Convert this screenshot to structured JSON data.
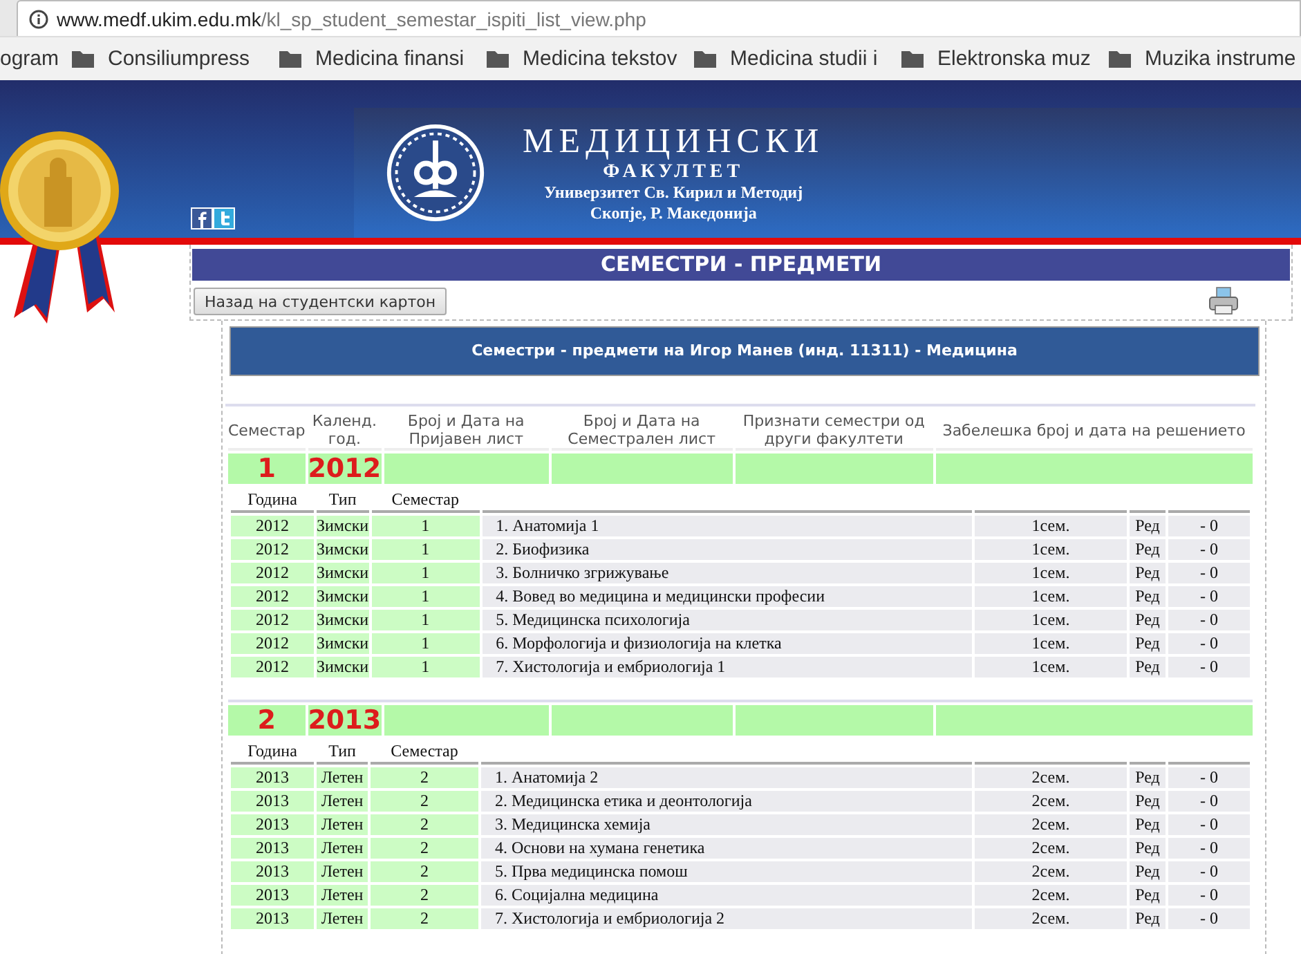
{
  "browser": {
    "url_host": "www.medf.ukim.edu.mk",
    "url_path": "/kl_sp_student_semestar_ispiti_list_view.php",
    "bookmarks": [
      {
        "label": "ogram",
        "folder": false
      },
      {
        "label": "Consiliumpress",
        "folder": true
      },
      {
        "label": "Medicina finansi",
        "folder": true
      },
      {
        "label": "Medicina tekstov",
        "folder": true
      },
      {
        "label": "Medicina studii i",
        "folder": true
      },
      {
        "label": "Elektronska muz",
        "folder": true
      },
      {
        "label": "Muzika instrume",
        "folder": true
      }
    ]
  },
  "header": {
    "title": "МЕДИЦИНСКИ",
    "subtitle": "ФАКУЛТЕТ",
    "university": "Универзитет Св. Кирил и Методиј",
    "city": "Скопје, Р. Македонија"
  },
  "page_title": "СЕМЕСТРИ - ПРЕДМЕТИ",
  "back_button": "Назад на студентски картон",
  "student_heading": "Семестри - предмети на Игор Манев  (инд. 11311) - Медицина",
  "columns": [
    "Семестар",
    "Календ. год.",
    "Број и Дата на Пријавен лист",
    "Број и Дата на Семестрален лист",
    "Признати семестри од други факултети",
    "Забелешка број и дата на решението"
  ],
  "semesters": [
    {
      "number": "1",
      "year": "2012",
      "subject_columns": [
        "Година",
        "Тип",
        "Семестар"
      ],
      "subjects": [
        {
          "year": "2012",
          "type": "Зимски",
          "semester": "1",
          "name": "1. Анатомија 1",
          "sem": "1сем.",
          "status": "Ред",
          "grade": "- 0"
        },
        {
          "year": "2012",
          "type": "Зимски",
          "semester": "1",
          "name": "2. Биофизика",
          "sem": "1сем.",
          "status": "Ред",
          "grade": "- 0"
        },
        {
          "year": "2012",
          "type": "Зимски",
          "semester": "1",
          "name": "3. Болничко згрижување",
          "sem": "1сем.",
          "status": "Ред",
          "grade": "- 0"
        },
        {
          "year": "2012",
          "type": "Зимски",
          "semester": "1",
          "name": "4. Вовед во медицина и медицински професии",
          "sem": "1сем.",
          "status": "Ред",
          "grade": "- 0"
        },
        {
          "year": "2012",
          "type": "Зимски",
          "semester": "1",
          "name": "5. Медицинска психологија",
          "sem": "1сем.",
          "status": "Ред",
          "grade": "- 0"
        },
        {
          "year": "2012",
          "type": "Зимски",
          "semester": "1",
          "name": "6. Морфологија и физиологија на клетка",
          "sem": "1сем.",
          "status": "Ред",
          "grade": "- 0"
        },
        {
          "year": "2012",
          "type": "Зимски",
          "semester": "1",
          "name": "7. Хистологија и ембриологија 1",
          "sem": "1сем.",
          "status": "Ред",
          "grade": "- 0"
        }
      ]
    },
    {
      "number": "2",
      "year": "2013",
      "subject_columns": [
        "Година",
        "Тип",
        "Семестар"
      ],
      "subjects": [
        {
          "year": "2013",
          "type": "Летен",
          "semester": "2",
          "name": "1. Анатомија 2",
          "sem": "2сем.",
          "status": "Ред",
          "grade": "- 0"
        },
        {
          "year": "2013",
          "type": "Летен",
          "semester": "2",
          "name": "2. Медицинска етика и деонтологија",
          "sem": "2сем.",
          "status": "Ред",
          "grade": "- 0"
        },
        {
          "year": "2013",
          "type": "Летен",
          "semester": "2",
          "name": "3. Медицинска хемија",
          "sem": "2сем.",
          "status": "Ред",
          "grade": "- 0"
        },
        {
          "year": "2013",
          "type": "Летен",
          "semester": "2",
          "name": "4. Основи на хумана генетика",
          "sem": "2сем.",
          "status": "Ред",
          "grade": "- 0"
        },
        {
          "year": "2013",
          "type": "Летен",
          "semester": "2",
          "name": "5. Прва медицинска помош",
          "sem": "2сем.",
          "status": "Ред",
          "grade": "- 0"
        },
        {
          "year": "2013",
          "type": "Летен",
          "semester": "2",
          "name": "6. Социјална медицина",
          "sem": "2сем.",
          "status": "Ред",
          "grade": "- 0"
        },
        {
          "year": "2013",
          "type": "Летен",
          "semester": "2",
          "name": "7. Хистологија и ембриологија 2",
          "sem": "2сем.",
          "status": "Ред",
          "grade": "- 0"
        }
      ]
    }
  ]
}
